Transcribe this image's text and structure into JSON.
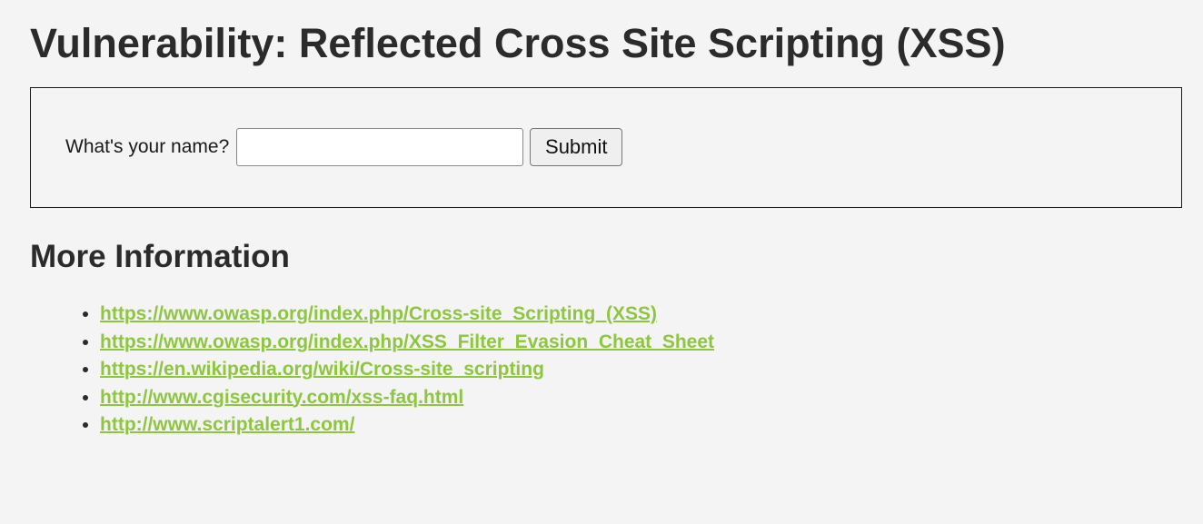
{
  "page": {
    "title": "Vulnerability: Reflected Cross Site Scripting (XSS)"
  },
  "form": {
    "label": "What's your name?",
    "input_value": "",
    "input_placeholder": "",
    "submit_label": "Submit"
  },
  "more_info": {
    "heading": "More Information",
    "links": [
      "https://www.owasp.org/index.php/Cross-site_Scripting_(XSS)",
      "https://www.owasp.org/index.php/XSS_Filter_Evasion_Cheat_Sheet",
      "https://en.wikipedia.org/wiki/Cross-site_scripting",
      "http://www.cgisecurity.com/xss-faq.html",
      "http://www.scriptalert1.com/"
    ]
  },
  "colors": {
    "background": "#f4f4f4",
    "link": "#8ec63f",
    "text": "#2b2b2b"
  }
}
